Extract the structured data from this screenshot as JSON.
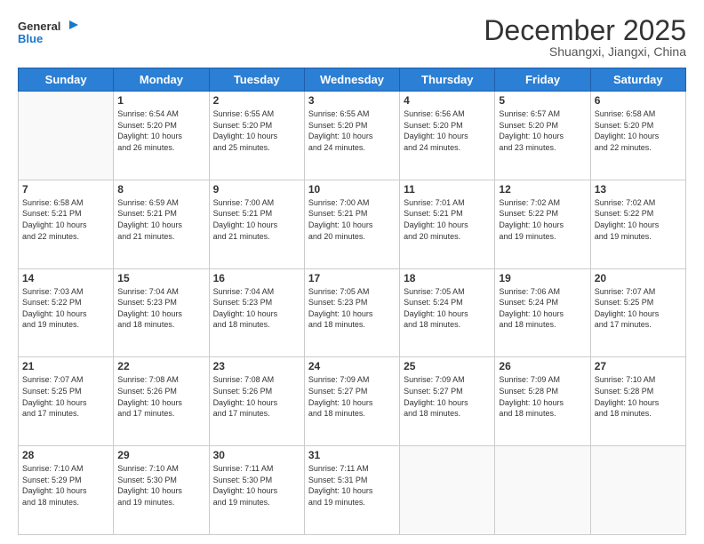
{
  "logo": {
    "line1": "General",
    "line2": "Blue"
  },
  "header": {
    "month": "December 2025",
    "location": "Shuangxi, Jiangxi, China"
  },
  "weekdays": [
    "Sunday",
    "Monday",
    "Tuesday",
    "Wednesday",
    "Thursday",
    "Friday",
    "Saturday"
  ],
  "weeks": [
    [
      {
        "day": "",
        "info": ""
      },
      {
        "day": "1",
        "info": "Sunrise: 6:54 AM\nSunset: 5:20 PM\nDaylight: 10 hours\nand 26 minutes."
      },
      {
        "day": "2",
        "info": "Sunrise: 6:55 AM\nSunset: 5:20 PM\nDaylight: 10 hours\nand 25 minutes."
      },
      {
        "day": "3",
        "info": "Sunrise: 6:55 AM\nSunset: 5:20 PM\nDaylight: 10 hours\nand 24 minutes."
      },
      {
        "day": "4",
        "info": "Sunrise: 6:56 AM\nSunset: 5:20 PM\nDaylight: 10 hours\nand 24 minutes."
      },
      {
        "day": "5",
        "info": "Sunrise: 6:57 AM\nSunset: 5:20 PM\nDaylight: 10 hours\nand 23 minutes."
      },
      {
        "day": "6",
        "info": "Sunrise: 6:58 AM\nSunset: 5:20 PM\nDaylight: 10 hours\nand 22 minutes."
      }
    ],
    [
      {
        "day": "7",
        "info": "Sunrise: 6:58 AM\nSunset: 5:21 PM\nDaylight: 10 hours\nand 22 minutes."
      },
      {
        "day": "8",
        "info": "Sunrise: 6:59 AM\nSunset: 5:21 PM\nDaylight: 10 hours\nand 21 minutes."
      },
      {
        "day": "9",
        "info": "Sunrise: 7:00 AM\nSunset: 5:21 PM\nDaylight: 10 hours\nand 21 minutes."
      },
      {
        "day": "10",
        "info": "Sunrise: 7:00 AM\nSunset: 5:21 PM\nDaylight: 10 hours\nand 20 minutes."
      },
      {
        "day": "11",
        "info": "Sunrise: 7:01 AM\nSunset: 5:21 PM\nDaylight: 10 hours\nand 20 minutes."
      },
      {
        "day": "12",
        "info": "Sunrise: 7:02 AM\nSunset: 5:22 PM\nDaylight: 10 hours\nand 19 minutes."
      },
      {
        "day": "13",
        "info": "Sunrise: 7:02 AM\nSunset: 5:22 PM\nDaylight: 10 hours\nand 19 minutes."
      }
    ],
    [
      {
        "day": "14",
        "info": "Sunrise: 7:03 AM\nSunset: 5:22 PM\nDaylight: 10 hours\nand 19 minutes."
      },
      {
        "day": "15",
        "info": "Sunrise: 7:04 AM\nSunset: 5:23 PM\nDaylight: 10 hours\nand 18 minutes."
      },
      {
        "day": "16",
        "info": "Sunrise: 7:04 AM\nSunset: 5:23 PM\nDaylight: 10 hours\nand 18 minutes."
      },
      {
        "day": "17",
        "info": "Sunrise: 7:05 AM\nSunset: 5:23 PM\nDaylight: 10 hours\nand 18 minutes."
      },
      {
        "day": "18",
        "info": "Sunrise: 7:05 AM\nSunset: 5:24 PM\nDaylight: 10 hours\nand 18 minutes."
      },
      {
        "day": "19",
        "info": "Sunrise: 7:06 AM\nSunset: 5:24 PM\nDaylight: 10 hours\nand 18 minutes."
      },
      {
        "day": "20",
        "info": "Sunrise: 7:07 AM\nSunset: 5:25 PM\nDaylight: 10 hours\nand 17 minutes."
      }
    ],
    [
      {
        "day": "21",
        "info": "Sunrise: 7:07 AM\nSunset: 5:25 PM\nDaylight: 10 hours\nand 17 minutes."
      },
      {
        "day": "22",
        "info": "Sunrise: 7:08 AM\nSunset: 5:26 PM\nDaylight: 10 hours\nand 17 minutes."
      },
      {
        "day": "23",
        "info": "Sunrise: 7:08 AM\nSunset: 5:26 PM\nDaylight: 10 hours\nand 17 minutes."
      },
      {
        "day": "24",
        "info": "Sunrise: 7:09 AM\nSunset: 5:27 PM\nDaylight: 10 hours\nand 18 minutes."
      },
      {
        "day": "25",
        "info": "Sunrise: 7:09 AM\nSunset: 5:27 PM\nDaylight: 10 hours\nand 18 minutes."
      },
      {
        "day": "26",
        "info": "Sunrise: 7:09 AM\nSunset: 5:28 PM\nDaylight: 10 hours\nand 18 minutes."
      },
      {
        "day": "27",
        "info": "Sunrise: 7:10 AM\nSunset: 5:28 PM\nDaylight: 10 hours\nand 18 minutes."
      }
    ],
    [
      {
        "day": "28",
        "info": "Sunrise: 7:10 AM\nSunset: 5:29 PM\nDaylight: 10 hours\nand 18 minutes."
      },
      {
        "day": "29",
        "info": "Sunrise: 7:10 AM\nSunset: 5:30 PM\nDaylight: 10 hours\nand 19 minutes."
      },
      {
        "day": "30",
        "info": "Sunrise: 7:11 AM\nSunset: 5:30 PM\nDaylight: 10 hours\nand 19 minutes."
      },
      {
        "day": "31",
        "info": "Sunrise: 7:11 AM\nSunset: 5:31 PM\nDaylight: 10 hours\nand 19 minutes."
      },
      {
        "day": "",
        "info": ""
      },
      {
        "day": "",
        "info": ""
      },
      {
        "day": "",
        "info": ""
      }
    ]
  ]
}
